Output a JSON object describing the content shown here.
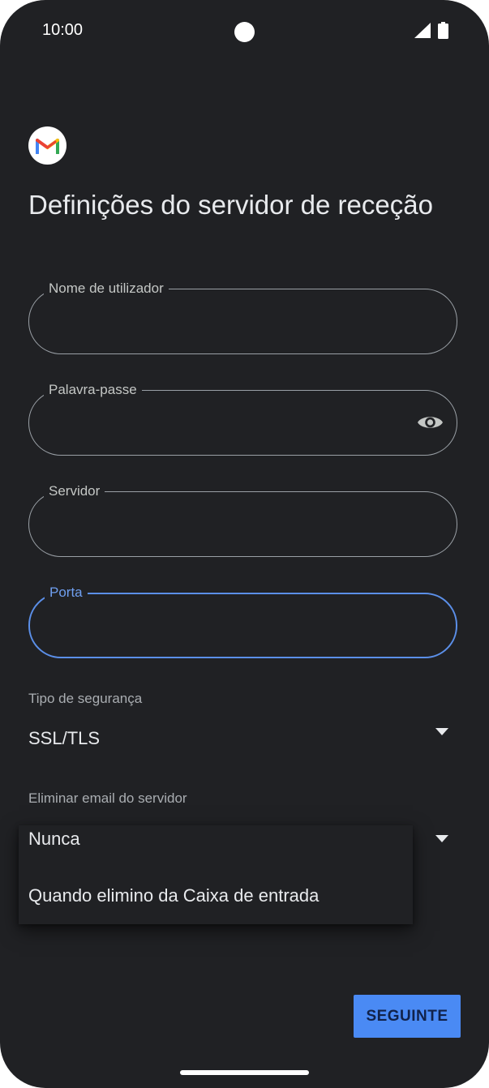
{
  "status_bar": {
    "time": "10:00"
  },
  "page": {
    "title": "Definições do servidor de receção"
  },
  "fields": {
    "username": {
      "label": "Nome de utilizador",
      "value": ""
    },
    "password": {
      "label": "Palavra-passe",
      "value": ""
    },
    "server": {
      "label": "Servidor",
      "value": ""
    },
    "port": {
      "label": "Porta",
      "value": ""
    }
  },
  "security": {
    "label": "Tipo de segurança",
    "value": "SSL/TLS"
  },
  "delete_from_server": {
    "label": "Eliminar email do servidor",
    "options": [
      "Nunca",
      "Quando elimino da Caixa de entrada"
    ]
  },
  "actions": {
    "next_label": "SEGUINTE"
  },
  "colors": {
    "background": "#202124",
    "accent": "#4a8af4",
    "focus_border": "#5b8fe8"
  },
  "icons": [
    "gmail-logo-icon",
    "eye-icon",
    "dropdown-arrow-icon",
    "signal-icon",
    "battery-icon"
  ]
}
